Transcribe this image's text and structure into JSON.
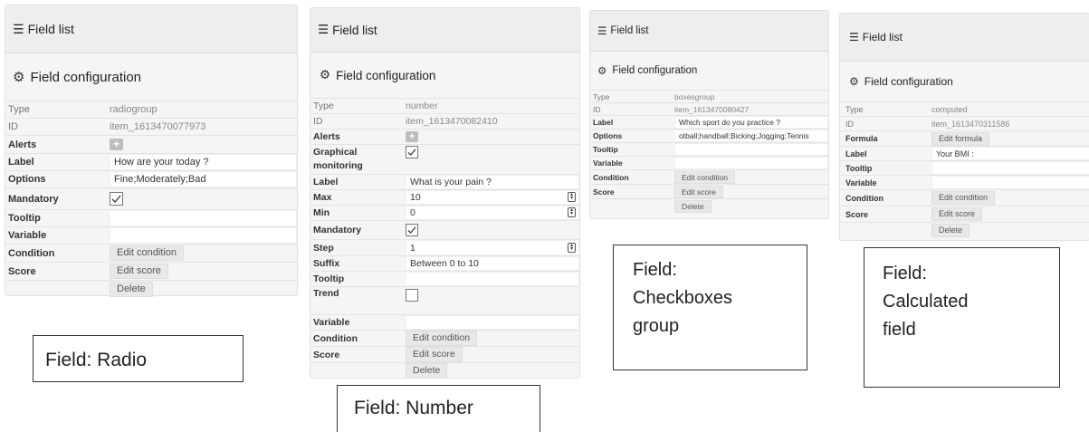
{
  "panels": {
    "radio": {
      "header": "Field list",
      "config_title": "Field configuration",
      "type_label": "Type",
      "type_value": "radiogroup",
      "id_label": "ID",
      "id_value": "item_1613470077973",
      "alerts_label": "Alerts",
      "label_label": "Label",
      "label_value": "How are your today ?",
      "options_label": "Options",
      "options_value": "Fine;Moderately;Bad",
      "mandatory_label": "Mandatory",
      "tooltip_label": "Tooltip",
      "variable_label": "Variable",
      "condition_label": "Condition",
      "edit_condition": "Edit condition",
      "score_label": "Score",
      "edit_score": "Edit score",
      "delete": "Delete"
    },
    "number": {
      "header": "Field list",
      "config_title": "Field configuration",
      "type_label": "Type",
      "type_value": "number",
      "id_label": "ID",
      "id_value": "item_1613470082410",
      "alerts_label": "Alerts",
      "graphical_label_1": "Graphical",
      "graphical_label_2": "monitoring",
      "label_label": "Label",
      "label_value": "What is your pain ?",
      "max_label": "Max",
      "max_value": "10",
      "min_label": "Min",
      "min_value": "0",
      "mandatory_label": "Mandatory",
      "step_label": "Step",
      "step_value": "1",
      "suffix_label": "Suffix",
      "suffix_value": "Between 0 to 10",
      "tooltip_label": "Tooltip",
      "trend_label": "Trend",
      "variable_label": "Variable",
      "condition_label": "Condition",
      "edit_condition": "Edit condition",
      "score_label": "Score",
      "edit_score": "Edit score",
      "delete": "Delete"
    },
    "checkboxes": {
      "header": "Field list",
      "config_title": "Field configuration",
      "type_label": "Type",
      "type_value": "boxesgroup",
      "id_label": "ID",
      "id_value": "item_1613470080427",
      "label_label": "Label",
      "label_value": "Which sport do you practice ?",
      "options_label": "Options",
      "options_value": "otball;handball;Bicking;Jogging;Tennis",
      "tooltip_label": "Tooltip",
      "variable_label": "Variable",
      "condition_label": "Condition",
      "edit_condition": "Edit condition",
      "score_label": "Score",
      "edit_score": "Edit score",
      "delete": "Delete"
    },
    "computed": {
      "header": "Field list",
      "config_title": "Field configuration",
      "type_label": "Type",
      "type_value": "computed",
      "id_label": "ID",
      "id_value": "item_1613470311586",
      "formula_label": "Formula",
      "edit_formula": "Edit formula",
      "label_label": "Label",
      "label_value": "Your BMI :",
      "tooltip_label": "Tooltip",
      "variable_label": "Variable",
      "condition_label": "Condition",
      "edit_condition": "Edit condition",
      "score_label": "Score",
      "edit_score": "Edit score",
      "delete": "Delete"
    }
  },
  "captions": {
    "radio": "Field: Radio",
    "number": "Field: Number",
    "checkboxes_1": "Field:",
    "checkboxes_2": "Checkboxes",
    "checkboxes_3": "group",
    "computed_1": "Field:",
    "computed_2": "Calculated",
    "computed_3": "field"
  },
  "icons": {
    "list": "hamburger-list-icon",
    "config": "cogs-icon",
    "plus": "plus-icon",
    "check": "check-icon",
    "spinner": "up-down-spinner-icon"
  }
}
